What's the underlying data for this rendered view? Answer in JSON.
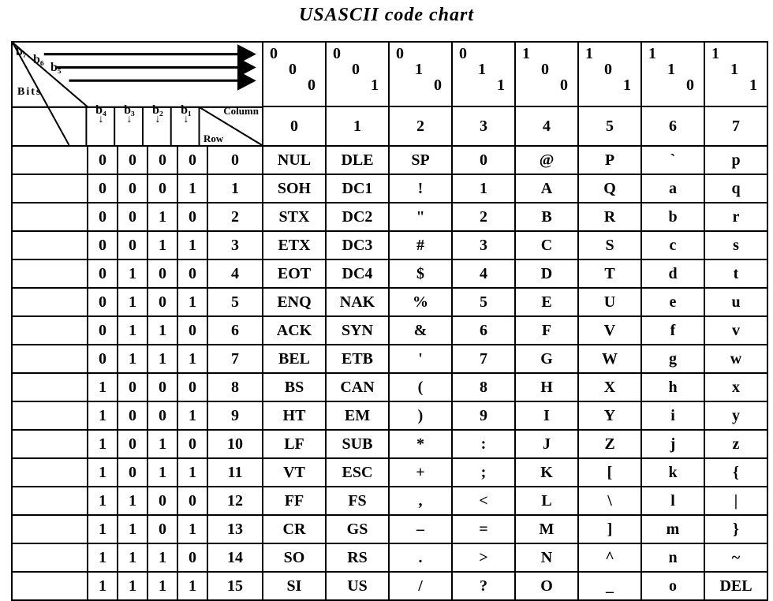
{
  "title": "USASCII code chart",
  "top_bit_labels": [
    "b₇",
    "b₆",
    "b₅"
  ],
  "bits_word": "Bits",
  "bit_col_headers": [
    "b₄",
    "b₃",
    "b₂",
    "b₁"
  ],
  "column_label": "Column",
  "row_label": "Row",
  "top_patterns": [
    [
      "0",
      "0",
      "0"
    ],
    [
      "0",
      "0",
      "1"
    ],
    [
      "0",
      "1",
      "0"
    ],
    [
      "0",
      "1",
      "1"
    ],
    [
      "1",
      "0",
      "0"
    ],
    [
      "1",
      "0",
      "1"
    ],
    [
      "1",
      "1",
      "0"
    ],
    [
      "1",
      "1",
      "1"
    ]
  ],
  "column_numbers": [
    "0",
    "1",
    "2",
    "3",
    "4",
    "5",
    "6",
    "7"
  ],
  "rows": [
    {
      "b": [
        "0",
        "0",
        "0",
        "0"
      ],
      "r": "0",
      "c": [
        "NUL",
        "DLE",
        "SP",
        "0",
        "@",
        "P",
        "`",
        "p"
      ]
    },
    {
      "b": [
        "0",
        "0",
        "0",
        "1"
      ],
      "r": "1",
      "c": [
        "SOH",
        "DC1",
        "!",
        "1",
        "A",
        "Q",
        "a",
        "q"
      ]
    },
    {
      "b": [
        "0",
        "0",
        "1",
        "0"
      ],
      "r": "2",
      "c": [
        "STX",
        "DC2",
        "\"",
        "2",
        "B",
        "R",
        "b",
        "r"
      ]
    },
    {
      "b": [
        "0",
        "0",
        "1",
        "1"
      ],
      "r": "3",
      "c": [
        "ETX",
        "DC3",
        "#",
        "3",
        "C",
        "S",
        "c",
        "s"
      ]
    },
    {
      "b": [
        "0",
        "1",
        "0",
        "0"
      ],
      "r": "4",
      "c": [
        "EOT",
        "DC4",
        "$",
        "4",
        "D",
        "T",
        "d",
        "t"
      ]
    },
    {
      "b": [
        "0",
        "1",
        "0",
        "1"
      ],
      "r": "5",
      "c": [
        "ENQ",
        "NAK",
        "%",
        "5",
        "E",
        "U",
        "e",
        "u"
      ]
    },
    {
      "b": [
        "0",
        "1",
        "1",
        "0"
      ],
      "r": "6",
      "c": [
        "ACK",
        "SYN",
        "&",
        "6",
        "F",
        "V",
        "f",
        "v"
      ]
    },
    {
      "b": [
        "0",
        "1",
        "1",
        "1"
      ],
      "r": "7",
      "c": [
        "BEL",
        "ETB",
        "'",
        "7",
        "G",
        "W",
        "g",
        "w"
      ]
    },
    {
      "b": [
        "1",
        "0",
        "0",
        "0"
      ],
      "r": "8",
      "c": [
        "BS",
        "CAN",
        "(",
        "8",
        "H",
        "X",
        "h",
        "x"
      ]
    },
    {
      "b": [
        "1",
        "0",
        "0",
        "1"
      ],
      "r": "9",
      "c": [
        "HT",
        "EM",
        ")",
        "9",
        "I",
        "Y",
        "i",
        "y"
      ]
    },
    {
      "b": [
        "1",
        "0",
        "1",
        "0"
      ],
      "r": "10",
      "c": [
        "LF",
        "SUB",
        "*",
        ":",
        "J",
        "Z",
        "j",
        "z"
      ]
    },
    {
      "b": [
        "1",
        "0",
        "1",
        "1"
      ],
      "r": "11",
      "c": [
        "VT",
        "ESC",
        "+",
        ";",
        "K",
        "[",
        "k",
        "{"
      ]
    },
    {
      "b": [
        "1",
        "1",
        "0",
        "0"
      ],
      "r": "12",
      "c": [
        "FF",
        "FS",
        ",",
        "<",
        "L",
        "\\",
        "l",
        "|"
      ]
    },
    {
      "b": [
        "1",
        "1",
        "0",
        "1"
      ],
      "r": "13",
      "c": [
        "CR",
        "GS",
        "–",
        "=",
        "M",
        "]",
        "m",
        "}"
      ]
    },
    {
      "b": [
        "1",
        "1",
        "1",
        "0"
      ],
      "r": "14",
      "c": [
        "SO",
        "RS",
        ".",
        ">",
        "N",
        "^",
        "n",
        "~"
      ]
    },
    {
      "b": [
        "1",
        "1",
        "1",
        "1"
      ],
      "r": "15",
      "c": [
        "SI",
        "US",
        "/",
        "?",
        "O",
        "_",
        "o",
        "DEL"
      ]
    }
  ],
  "chart_data": {
    "type": "table",
    "title": "USASCII code chart",
    "column_bits_b7_b6_b5": [
      "000",
      "001",
      "010",
      "011",
      "100",
      "101",
      "110",
      "111"
    ],
    "row_bits_b4_b3_b2_b1": [
      "0000",
      "0001",
      "0010",
      "0011",
      "0100",
      "0101",
      "0110",
      "0111",
      "1000",
      "1001",
      "1010",
      "1011",
      "1100",
      "1101",
      "1110",
      "1111"
    ],
    "columns": [
      0,
      1,
      2,
      3,
      4,
      5,
      6,
      7
    ],
    "rows": [
      0,
      1,
      2,
      3,
      4,
      5,
      6,
      7,
      8,
      9,
      10,
      11,
      12,
      13,
      14,
      15
    ],
    "grid": [
      [
        "NUL",
        "DLE",
        "SP",
        "0",
        "@",
        "P",
        "`",
        "p"
      ],
      [
        "SOH",
        "DC1",
        "!",
        "1",
        "A",
        "Q",
        "a",
        "q"
      ],
      [
        "STX",
        "DC2",
        "\"",
        "2",
        "B",
        "R",
        "b",
        "r"
      ],
      [
        "ETX",
        "DC3",
        "#",
        "3",
        "C",
        "S",
        "c",
        "s"
      ],
      [
        "EOT",
        "DC4",
        "$",
        "4",
        "D",
        "T",
        "d",
        "t"
      ],
      [
        "ENQ",
        "NAK",
        "%",
        "5",
        "E",
        "U",
        "e",
        "u"
      ],
      [
        "ACK",
        "SYN",
        "&",
        "6",
        "F",
        "V",
        "f",
        "v"
      ],
      [
        "BEL",
        "ETB",
        "'",
        "7",
        "G",
        "W",
        "g",
        "w"
      ],
      [
        "BS",
        "CAN",
        "(",
        "8",
        "H",
        "X",
        "h",
        "x"
      ],
      [
        "HT",
        "EM",
        ")",
        "9",
        "I",
        "Y",
        "i",
        "y"
      ],
      [
        "LF",
        "SUB",
        "*",
        ":",
        "J",
        "Z",
        "j",
        "z"
      ],
      [
        "VT",
        "ESC",
        "+",
        ";",
        "K",
        "[",
        "k",
        "{"
      ],
      [
        "FF",
        "FS",
        ",",
        "<",
        "L",
        "\\",
        "l",
        "|"
      ],
      [
        "CR",
        "GS",
        "-",
        "=",
        "M",
        "]",
        "m",
        "}"
      ],
      [
        "SO",
        "RS",
        ".",
        ">",
        "N",
        "^",
        "n",
        "~"
      ],
      [
        "SI",
        "US",
        "/",
        "?",
        "O",
        "_",
        "o",
        "DEL"
      ]
    ]
  }
}
